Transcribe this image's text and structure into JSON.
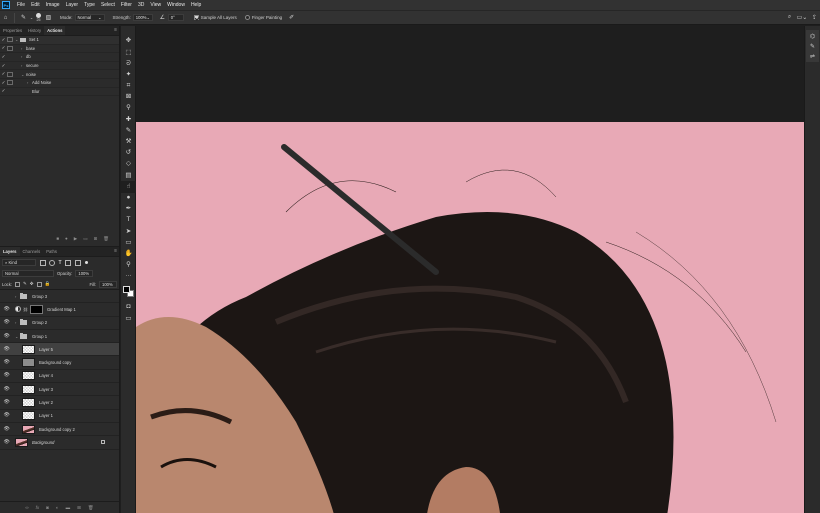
{
  "menubar": {
    "items": [
      "File",
      "Edit",
      "Image",
      "Layer",
      "Type",
      "Select",
      "Filter",
      "3D",
      "View",
      "Window",
      "Help"
    ]
  },
  "options": {
    "brush_size": "25",
    "mode_label": "Mode:",
    "mode_value": "Normal",
    "strength_label": "Strength:",
    "strength_value": "100%",
    "angle_value": "0°",
    "sample_all_layers": "Sample All Layers",
    "finger_painting": "Finger Painting"
  },
  "actions_panel": {
    "tabs": [
      "Properties",
      "History",
      "Actions"
    ],
    "active_tab": "Actions",
    "rows": [
      {
        "label": "Set 1",
        "checked": true,
        "dialog": true,
        "caret": "⌄",
        "folder": true,
        "indent": 0
      },
      {
        "label": "base",
        "checked": true,
        "dialog": true,
        "caret": "›",
        "folder": false,
        "indent": 1
      },
      {
        "label": "db",
        "checked": true,
        "dialog": false,
        "caret": "›",
        "folder": false,
        "indent": 1
      },
      {
        "label": "secure",
        "checked": true,
        "dialog": false,
        "caret": "›",
        "folder": false,
        "indent": 1
      },
      {
        "label": "noise",
        "checked": true,
        "dialog": true,
        "caret": "⌄",
        "folder": false,
        "indent": 1
      },
      {
        "label": "Add Noise",
        "checked": true,
        "dialog": true,
        "caret": "›",
        "folder": false,
        "indent": 2
      },
      {
        "label": "Blur",
        "checked": true,
        "dialog": false,
        "caret": "",
        "folder": false,
        "indent": 2
      }
    ]
  },
  "layers_panel": {
    "tabs": [
      "Layers",
      "Channels",
      "Paths"
    ],
    "active_tab": "Layers",
    "filter_kind": "Kind",
    "blend_mode": "Normal",
    "opacity_label": "Opacity:",
    "opacity_value": "100%",
    "lock_label": "Lock:",
    "fill_label": "Fill:",
    "fill_value": "100%",
    "layers": [
      {
        "name": "Group 3",
        "type": "group",
        "visible": false,
        "indent": 0,
        "caret": "›"
      },
      {
        "name": "Gradient Map 1",
        "type": "adjustment",
        "visible": true,
        "indent": 0
      },
      {
        "name": "Group 2",
        "type": "group",
        "visible": true,
        "indent": 0,
        "caret": "›"
      },
      {
        "name": "Group 1",
        "type": "group",
        "visible": true,
        "indent": 0,
        "caret": "⌄"
      },
      {
        "name": "Layer 5",
        "type": "checker",
        "visible": true,
        "indent": 1,
        "selected": true
      },
      {
        "name": "Background copy",
        "type": "gray",
        "visible": true,
        "indent": 1
      },
      {
        "name": "Layer 4",
        "type": "checker",
        "visible": true,
        "indent": 1
      },
      {
        "name": "Layer 3",
        "type": "checker",
        "visible": true,
        "indent": 1
      },
      {
        "name": "Layer 2",
        "type": "checker",
        "visible": true,
        "indent": 1
      },
      {
        "name": "Layer 1",
        "type": "checker",
        "visible": true,
        "indent": 1
      },
      {
        "name": "Background copy 2",
        "type": "photo",
        "visible": true,
        "indent": 1
      },
      {
        "name": "Background",
        "type": "photo",
        "visible": true,
        "indent": 0,
        "locked": true,
        "italic": true
      }
    ]
  },
  "toolbar": {
    "tools": [
      "move-tool",
      "marquee-tool",
      "lasso-tool",
      "quick-select-tool",
      "crop-tool",
      "frame-tool",
      "eyedropper-tool",
      "healing-tool",
      "brush-tool",
      "stamp-tool",
      "history-brush-tool",
      "eraser-tool",
      "gradient-tool",
      "smudge-tool",
      "dodge-tool",
      "pen-tool",
      "type-tool",
      "path-select-tool",
      "rectangle-tool",
      "hand-tool",
      "zoom-tool",
      "more-tools"
    ],
    "active_tool": "smudge-tool"
  },
  "colors": {
    "foreground": "#000000",
    "background": "#ffffff",
    "canvas_pink": "#e8a9b6",
    "hair_dark": "#1c1614",
    "skin": "#b9876e"
  }
}
